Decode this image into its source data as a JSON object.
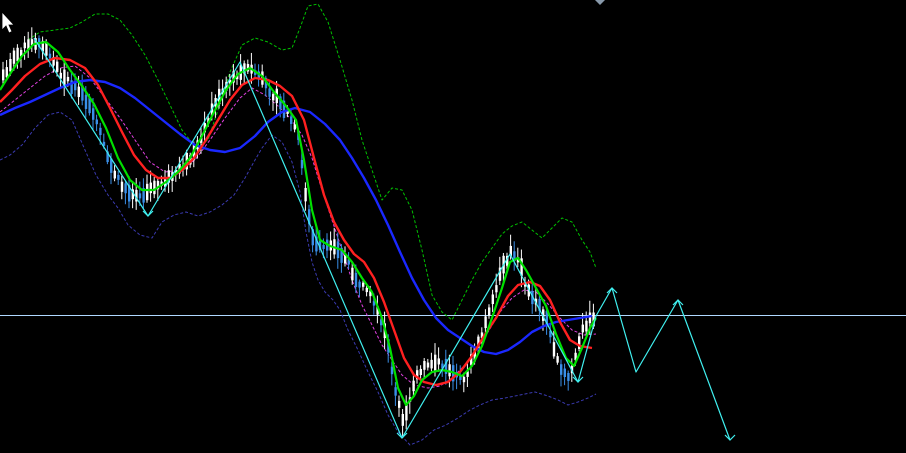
{
  "chart": {
    "background": "#000000",
    "bull_candle_color": "#ffffff",
    "bear_candle_color": "#3a8fe8",
    "price_line_color": "#b0d8ff",
    "cursor_icon": "mouse-pointer-icon",
    "indicators": [
      {
        "id": "ma-fast",
        "color": "#00e000",
        "style": "solid"
      },
      {
        "id": "ma-medium",
        "color": "#ff2020",
        "style": "solid"
      },
      {
        "id": "ma-slow",
        "color": "#1a28ff",
        "style": "solid"
      },
      {
        "id": "band-upper",
        "color": "#00c000",
        "style": "dashed"
      },
      {
        "id": "band-lower",
        "color": "#3a3ab0",
        "style": "dashed"
      },
      {
        "id": "band-middle",
        "color": "#e040e0",
        "style": "dashed"
      },
      {
        "id": "zigzag",
        "color": "#40f0f0",
        "style": "solid"
      }
    ]
  }
}
